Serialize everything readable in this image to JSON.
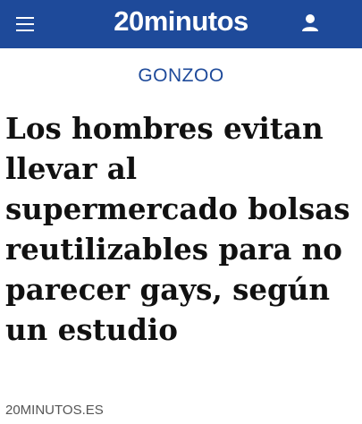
{
  "header": {
    "logo": "20minutos",
    "background_color": "#1e4a9a",
    "menu_icon": "hamburger-menu-icon",
    "user_icon": "user-icon"
  },
  "article": {
    "section": "GONZOO",
    "title": "Los hombres evitan llevar al supermercado bolsas reutilizables para no parecer gays, según un estudio",
    "source": "20MINUTOS.ES"
  }
}
